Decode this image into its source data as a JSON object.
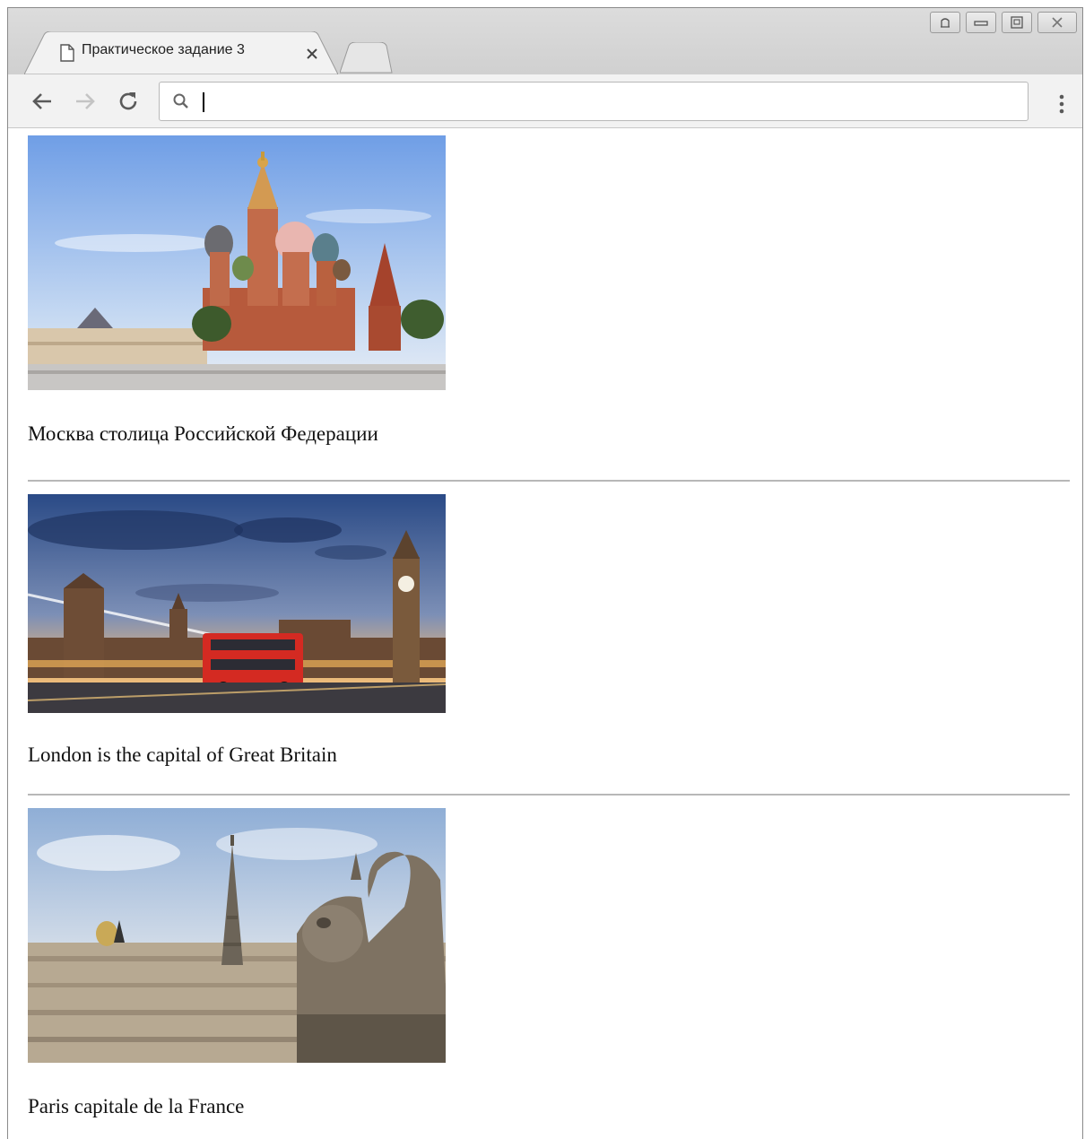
{
  "browser": {
    "tab_title": "Практическое задание 3",
    "address_value": "",
    "icons": {
      "back": "arrow-left-icon",
      "forward": "arrow-right-icon",
      "reload": "reload-icon",
      "search": "search-icon",
      "menu": "kebab-menu-icon",
      "tab_page": "page-icon",
      "tab_close": "close-icon"
    }
  },
  "content": {
    "items": [
      {
        "caption": "Москва столица Российской Федерации",
        "image": "Saint Basil's Cathedral, Red Square"
      },
      {
        "caption": "London is the capital of Great Britain",
        "image": "Big Ben and red double-decker bus"
      },
      {
        "caption": "Paris capitale de la France",
        "image": "Eiffel Tower and gargoyle of Notre-Dame"
      }
    ]
  },
  "colors": {
    "sky_moscow": "#8fb4ea",
    "sky_london": "#3a5a9a",
    "bus_red": "#d42a22",
    "sky_paris": "#c9d6e6"
  }
}
